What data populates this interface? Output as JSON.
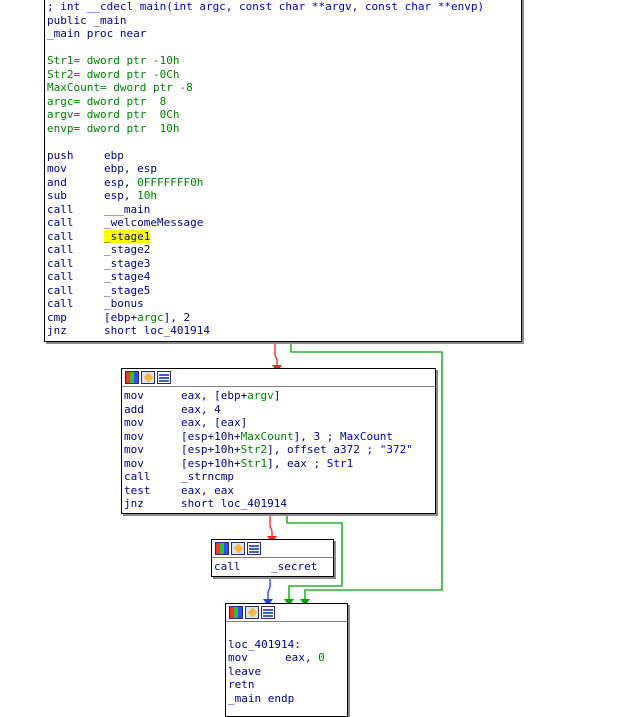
{
  "nodes": {
    "main": {
      "lines": [
        [
          {
            "t": "; int __cdecl main(int argc, const char **argv, const char **envp)",
            "c": "comment"
          }
        ],
        [
          {
            "t": "public _main",
            "c": "default"
          }
        ],
        [
          {
            "t": "_main proc near",
            "c": "default"
          }
        ],
        [
          {
            "t": "",
            "c": "default"
          }
        ],
        [
          {
            "t": "Str1= dword ptr -10h",
            "c": "green"
          }
        ],
        [
          {
            "t": "Str2= dword ptr -0Ch",
            "c": "green"
          }
        ],
        [
          {
            "t": "MaxCount= dword ptr -8",
            "c": "green"
          }
        ],
        [
          {
            "t": "argc= dword ptr  8",
            "c": "green"
          }
        ],
        [
          {
            "t": "argv= dword ptr  0Ch",
            "c": "green"
          }
        ],
        [
          {
            "t": "envp= dword ptr  10h",
            "c": "green"
          }
        ],
        [
          {
            "t": "",
            "c": "default"
          }
        ],
        [
          {
            "mn": "push"
          },
          {
            "t": "ebp",
            "c": "default"
          }
        ],
        [
          {
            "mn": "mov"
          },
          {
            "t": "ebp, esp",
            "c": "default"
          }
        ],
        [
          {
            "mn": "and"
          },
          {
            "t": "esp, ",
            "c": "default"
          },
          {
            "t": "0FFFFFFF0h",
            "c": "green"
          }
        ],
        [
          {
            "mn": "sub"
          },
          {
            "t": "esp, ",
            "c": "default"
          },
          {
            "t": "10h",
            "c": "green"
          }
        ],
        [
          {
            "mn": "call"
          },
          {
            "t": "___main",
            "c": "default"
          }
        ],
        [
          {
            "mn": "call"
          },
          {
            "t": "_welcomeMessage",
            "c": "default"
          }
        ],
        [
          {
            "mn": "call"
          },
          {
            "t": "_stage1",
            "c": "default",
            "hl": true
          }
        ],
        [
          {
            "mn": "call"
          },
          {
            "t": "_stage2",
            "c": "default"
          }
        ],
        [
          {
            "mn": "call"
          },
          {
            "t": "_stage3",
            "c": "default"
          }
        ],
        [
          {
            "mn": "call"
          },
          {
            "t": "_stage4",
            "c": "default"
          }
        ],
        [
          {
            "mn": "call"
          },
          {
            "t": "_stage5",
            "c": "default"
          }
        ],
        [
          {
            "mn": "call"
          },
          {
            "t": "_bonus",
            "c": "default"
          }
        ],
        [
          {
            "mn": "cmp"
          },
          {
            "t": "[ebp+",
            "c": "default"
          },
          {
            "t": "argc",
            "c": "green"
          },
          {
            "t": "], 2",
            "c": "default"
          }
        ],
        [
          {
            "mn": "jnz"
          },
          {
            "t": "short loc_401914",
            "c": "default"
          }
        ]
      ]
    },
    "strncmp": {
      "lines": [
        [
          {
            "mn": "mov"
          },
          {
            "t": "eax, [ebp+",
            "c": "default"
          },
          {
            "t": "argv",
            "c": "green"
          },
          {
            "t": "]",
            "c": "default"
          }
        ],
        [
          {
            "mn": "add"
          },
          {
            "t": "eax, 4",
            "c": "default"
          }
        ],
        [
          {
            "mn": "mov"
          },
          {
            "t": "eax, [eax]",
            "c": "default"
          }
        ],
        [
          {
            "mn": "mov"
          },
          {
            "t": "[esp+10h+",
            "c": "default"
          },
          {
            "t": "MaxCount",
            "c": "green"
          },
          {
            "t": "], 3 ; ",
            "c": "default"
          },
          {
            "t": "MaxCount",
            "c": "comment"
          }
        ],
        [
          {
            "mn": "mov"
          },
          {
            "t": "[esp+10h+",
            "c": "default"
          },
          {
            "t": "Str2",
            "c": "green"
          },
          {
            "t": "], offset a372 ",
            "c": "default"
          },
          {
            "t": "; \"372\"",
            "c": "comment"
          }
        ],
        [
          {
            "mn": "mov"
          },
          {
            "t": "[esp+10h+",
            "c": "default"
          },
          {
            "t": "Str1",
            "c": "green"
          },
          {
            "t": "], eax ; ",
            "c": "default"
          },
          {
            "t": "Str1",
            "c": "comment"
          }
        ],
        [
          {
            "mn": "call"
          },
          {
            "t": "_strncmp",
            "c": "default"
          }
        ],
        [
          {
            "mn": "test"
          },
          {
            "t": "eax, eax",
            "c": "default"
          }
        ],
        [
          {
            "mn": "jnz"
          },
          {
            "t": "short loc_401914",
            "c": "default"
          }
        ]
      ]
    },
    "secret": {
      "lines": [
        [
          {
            "mn": "call"
          },
          {
            "t": "_secret",
            "c": "default"
          }
        ]
      ]
    },
    "exit": {
      "lines": [
        [
          {
            "t": "",
            "c": "default"
          }
        ],
        [
          {
            "t": "loc_401914:",
            "c": "default"
          }
        ],
        [
          {
            "mn": "mov"
          },
          {
            "t": "eax, ",
            "c": "default"
          },
          {
            "t": "0",
            "c": "green"
          }
        ],
        [
          {
            "t": "leave",
            "c": "default"
          }
        ],
        [
          {
            "t": "retn",
            "c": "default"
          }
        ],
        [
          {
            "t": "_main endp",
            "c": "default"
          }
        ]
      ]
    }
  },
  "colors": {
    "edge_true": "#2040ff",
    "edge_false": "#ff2020",
    "edge_uncond": "#00a000",
    "highlight": "#ffff00"
  }
}
